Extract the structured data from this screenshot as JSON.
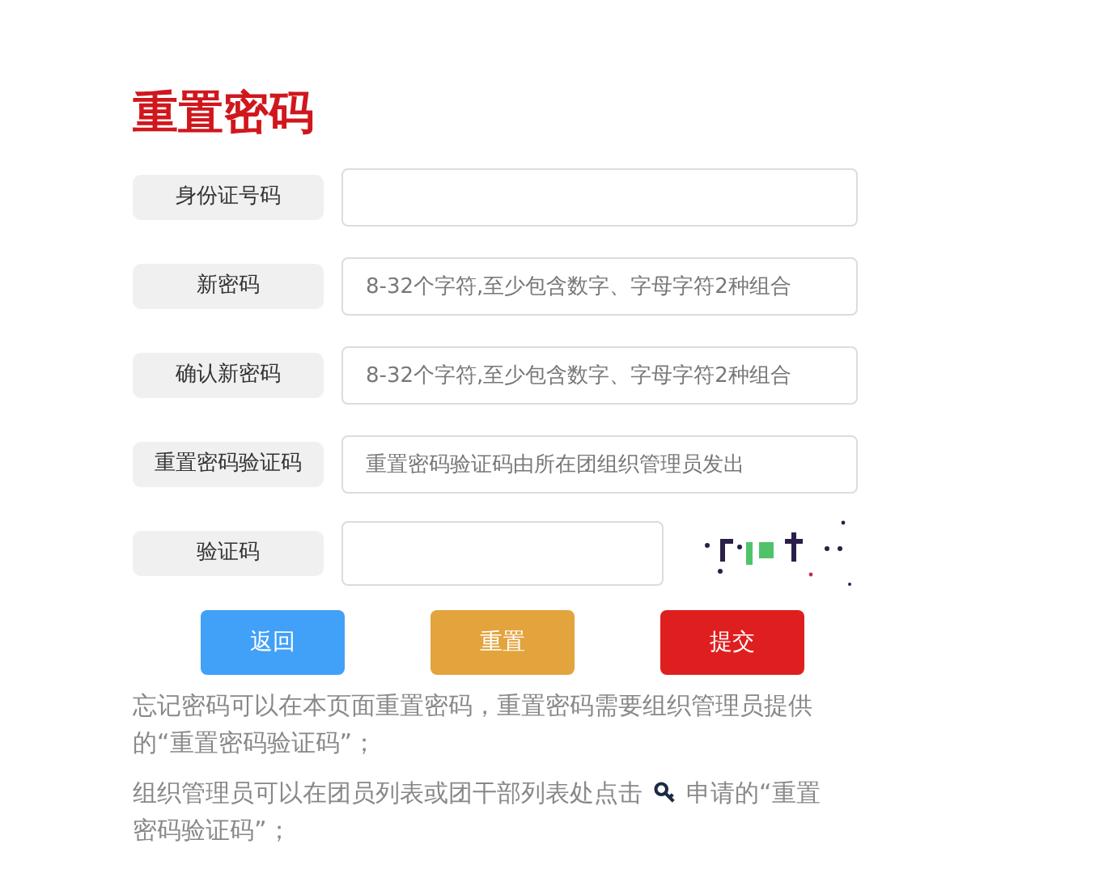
{
  "title": "重置密码",
  "fields": [
    {
      "label": "身份证号码",
      "kind": "text"
    },
    {
      "label": "新密码",
      "kind": "text",
      "placeholder": "8-32个字符,至少包含数字、字母字符2种组合"
    },
    {
      "label": "确认新密码",
      "kind": "text",
      "placeholder": "8-32个字符,至少包含数字、字母字符2种组合"
    },
    {
      "label": "重置密码验证码",
      "kind": "text",
      "placeholder": "重置密码验证码由所在团组织管理员发出"
    },
    {
      "label": "验证码",
      "kind": "captcha"
    }
  ],
  "buttons": [
    {
      "label": "返回",
      "kind": "back"
    },
    {
      "label": "重置",
      "kind": "reset"
    },
    {
      "label": "提交",
      "kind": "submit"
    }
  ],
  "notes": [
    {
      "lines": [
        [
          {
            "kind": "text",
            "text": "忘记密码可以在本页面重置密码，重置密码需要组织管理员提供"
          }
        ],
        [
          {
            "kind": "text",
            "text": "的“重置密码验证码”；"
          }
        ]
      ]
    },
    {
      "lines": [
        [
          {
            "kind": "text",
            "text": "组织管理员可以在团员列表或团干部列表处点击"
          },
          {
            "kind": "icon"
          },
          {
            "kind": "text",
            "text": "申请的“重置"
          }
        ],
        [
          {
            "kind": "text",
            "text": "密码验证码”；"
          }
        ]
      ]
    }
  ]
}
